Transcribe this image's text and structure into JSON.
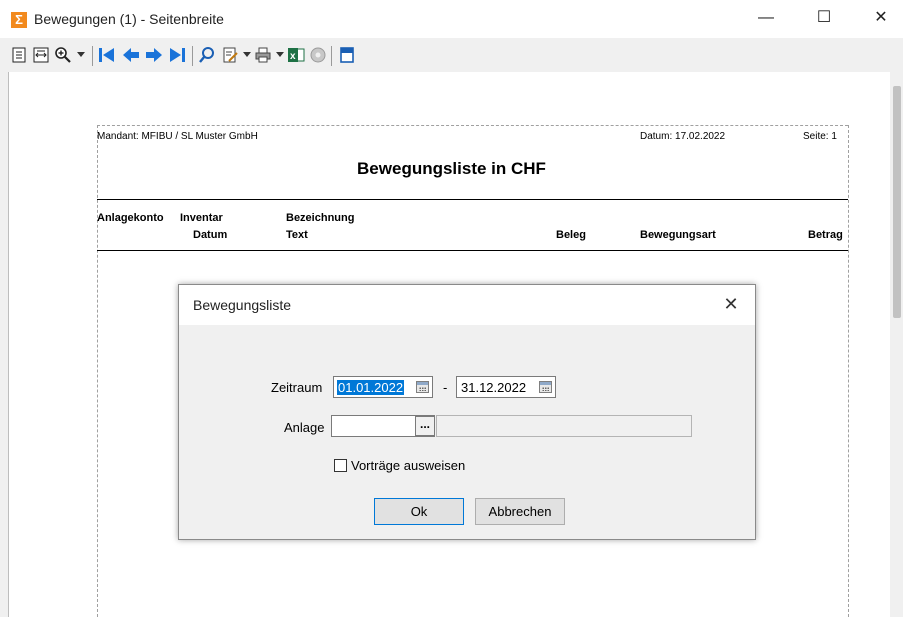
{
  "window": {
    "title": "Bewegungen (1) - Seitenbreite",
    "app_icon": "sigma-icon",
    "min_glyph": "—",
    "max_glyph": "☐",
    "close_glyph": "✕"
  },
  "toolbar": {
    "icons": [
      "single-page-icon",
      "page-width-icon",
      "zoom-icon",
      "first-page-icon",
      "previous-page-icon",
      "next-page-icon",
      "last-page-icon",
      "search-icon",
      "export-icon",
      "print-icon",
      "excel-icon",
      "disc-icon",
      "close-preview-icon"
    ]
  },
  "report": {
    "mandant": "Mandant:  MFIBU  /  SL Muster GmbH",
    "datum": "Datum:  17.02.2022",
    "seite": "Seite:   1",
    "title": "Bewegungsliste in CHF",
    "columns": {
      "anlagekonto": "Anlagekonto",
      "inventar": "Inventar",
      "datum": "Datum",
      "bezeichnung": "Bezeichnung",
      "text": "Text",
      "beleg": "Beleg",
      "bewegungsart": "Bewegungsart",
      "betrag": "Betrag"
    }
  },
  "dialog": {
    "title": "Bewegungsliste",
    "close_glyph": "✕",
    "zeitraum_label": "Zeitraum",
    "date_from": "01.01.2022",
    "date_sep": "-",
    "date_to": "31.12.2022",
    "anlage_label": "Anlage",
    "anlage_value": "",
    "browse_label": "...",
    "vortraege_label": "Vorträge ausweisen",
    "vortraege_checked": false,
    "ok_label": "Ok",
    "cancel_label": "Abbrechen"
  },
  "colors": {
    "accent": "#0078d7",
    "app_icon": "#f28a1e"
  }
}
